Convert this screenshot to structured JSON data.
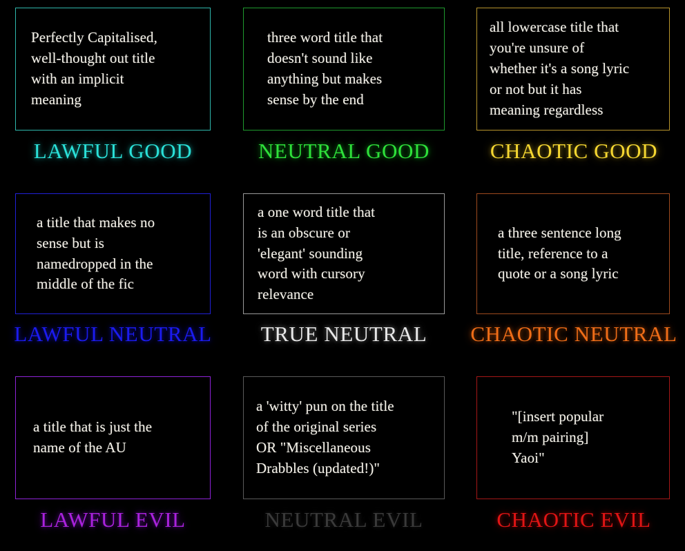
{
  "meta": {
    "background_color": "#000000",
    "body_text_color": "#f2efe6"
  },
  "cells": [
    {
      "id": "lawful-good",
      "label": "LAWFUL GOOD",
      "text": "Perfectly Capitalised,\nwell-thought out title\nwith an implicit\nmeaning",
      "border_color": "#2fb8ad",
      "label_color": "#2ae0d8",
      "glow_color": "#12706c"
    },
    {
      "id": "neutral-good",
      "label": "NEUTRAL GOOD",
      "text": "three word title that\ndoesn't sound like\nanything but makes\nsense by the end",
      "border_color": "#1f9a2e",
      "label_color": "#2ee03a",
      "glow_color": "#0d6a14"
    },
    {
      "id": "chaotic-good",
      "label": "CHAOTIC GOOD",
      "text": "all lowercase title that\nyou're unsure of\nwhether it's a song lyric\nor not but it has\nmeaning regardless",
      "border_color": "#b8952c",
      "label_color": "#f5d731",
      "glow_color": "#6b5a12"
    },
    {
      "id": "lawful-neutral",
      "label": "LAWFUL NEUTRAL",
      "text": "a title that makes no\nsense but is\nnamedropped in the\nmiddle of the fic",
      "border_color": "#2020d8",
      "label_color": "#1b1bef",
      "glow_color": "#0d0d80"
    },
    {
      "id": "true-neutral",
      "label": "TRUE NEUTRAL",
      "text": "a one word title that\nis an obscure or\n'elegant' sounding\nword with cursory\nrelevance",
      "border_color": "#9a9a9a",
      "label_color": "#e8e8e8",
      "glow_color": "#555555"
    },
    {
      "id": "chaotic-neutral",
      "label": "CHAOTIC NEUTRAL",
      "text": "a three sentence long\ntitle, reference to a\nquote or a song lyric",
      "border_color": "#9e4a1e",
      "label_color": "#ef6d18",
      "glow_color": "#7a3408"
    },
    {
      "id": "lawful-evil",
      "label": "LAWFUL EVIL",
      "text": "a title that is just the\nname of the AU",
      "border_color": "#8f23d8",
      "label_color": "#aa22dd",
      "glow_color": "#4d0f77"
    },
    {
      "id": "neutral-evil",
      "label": "NEUTRAL EVIL",
      "text": "a 'witty' pun on the title\nof the original series\nOR \"Miscellaneous\nDrabbles (updated!)\"",
      "border_color": "#5a5a5a",
      "label_color": "#3a3a3a",
      "glow_color": "#1a1a1a"
    },
    {
      "id": "chaotic-evil",
      "label": "CHAOTIC EVIL",
      "text": "\"[insert popular\nm/m pairing]\nYaoi\"",
      "border_color": "#a51717",
      "label_color": "#e01414",
      "glow_color": "#6e0707"
    }
  ]
}
